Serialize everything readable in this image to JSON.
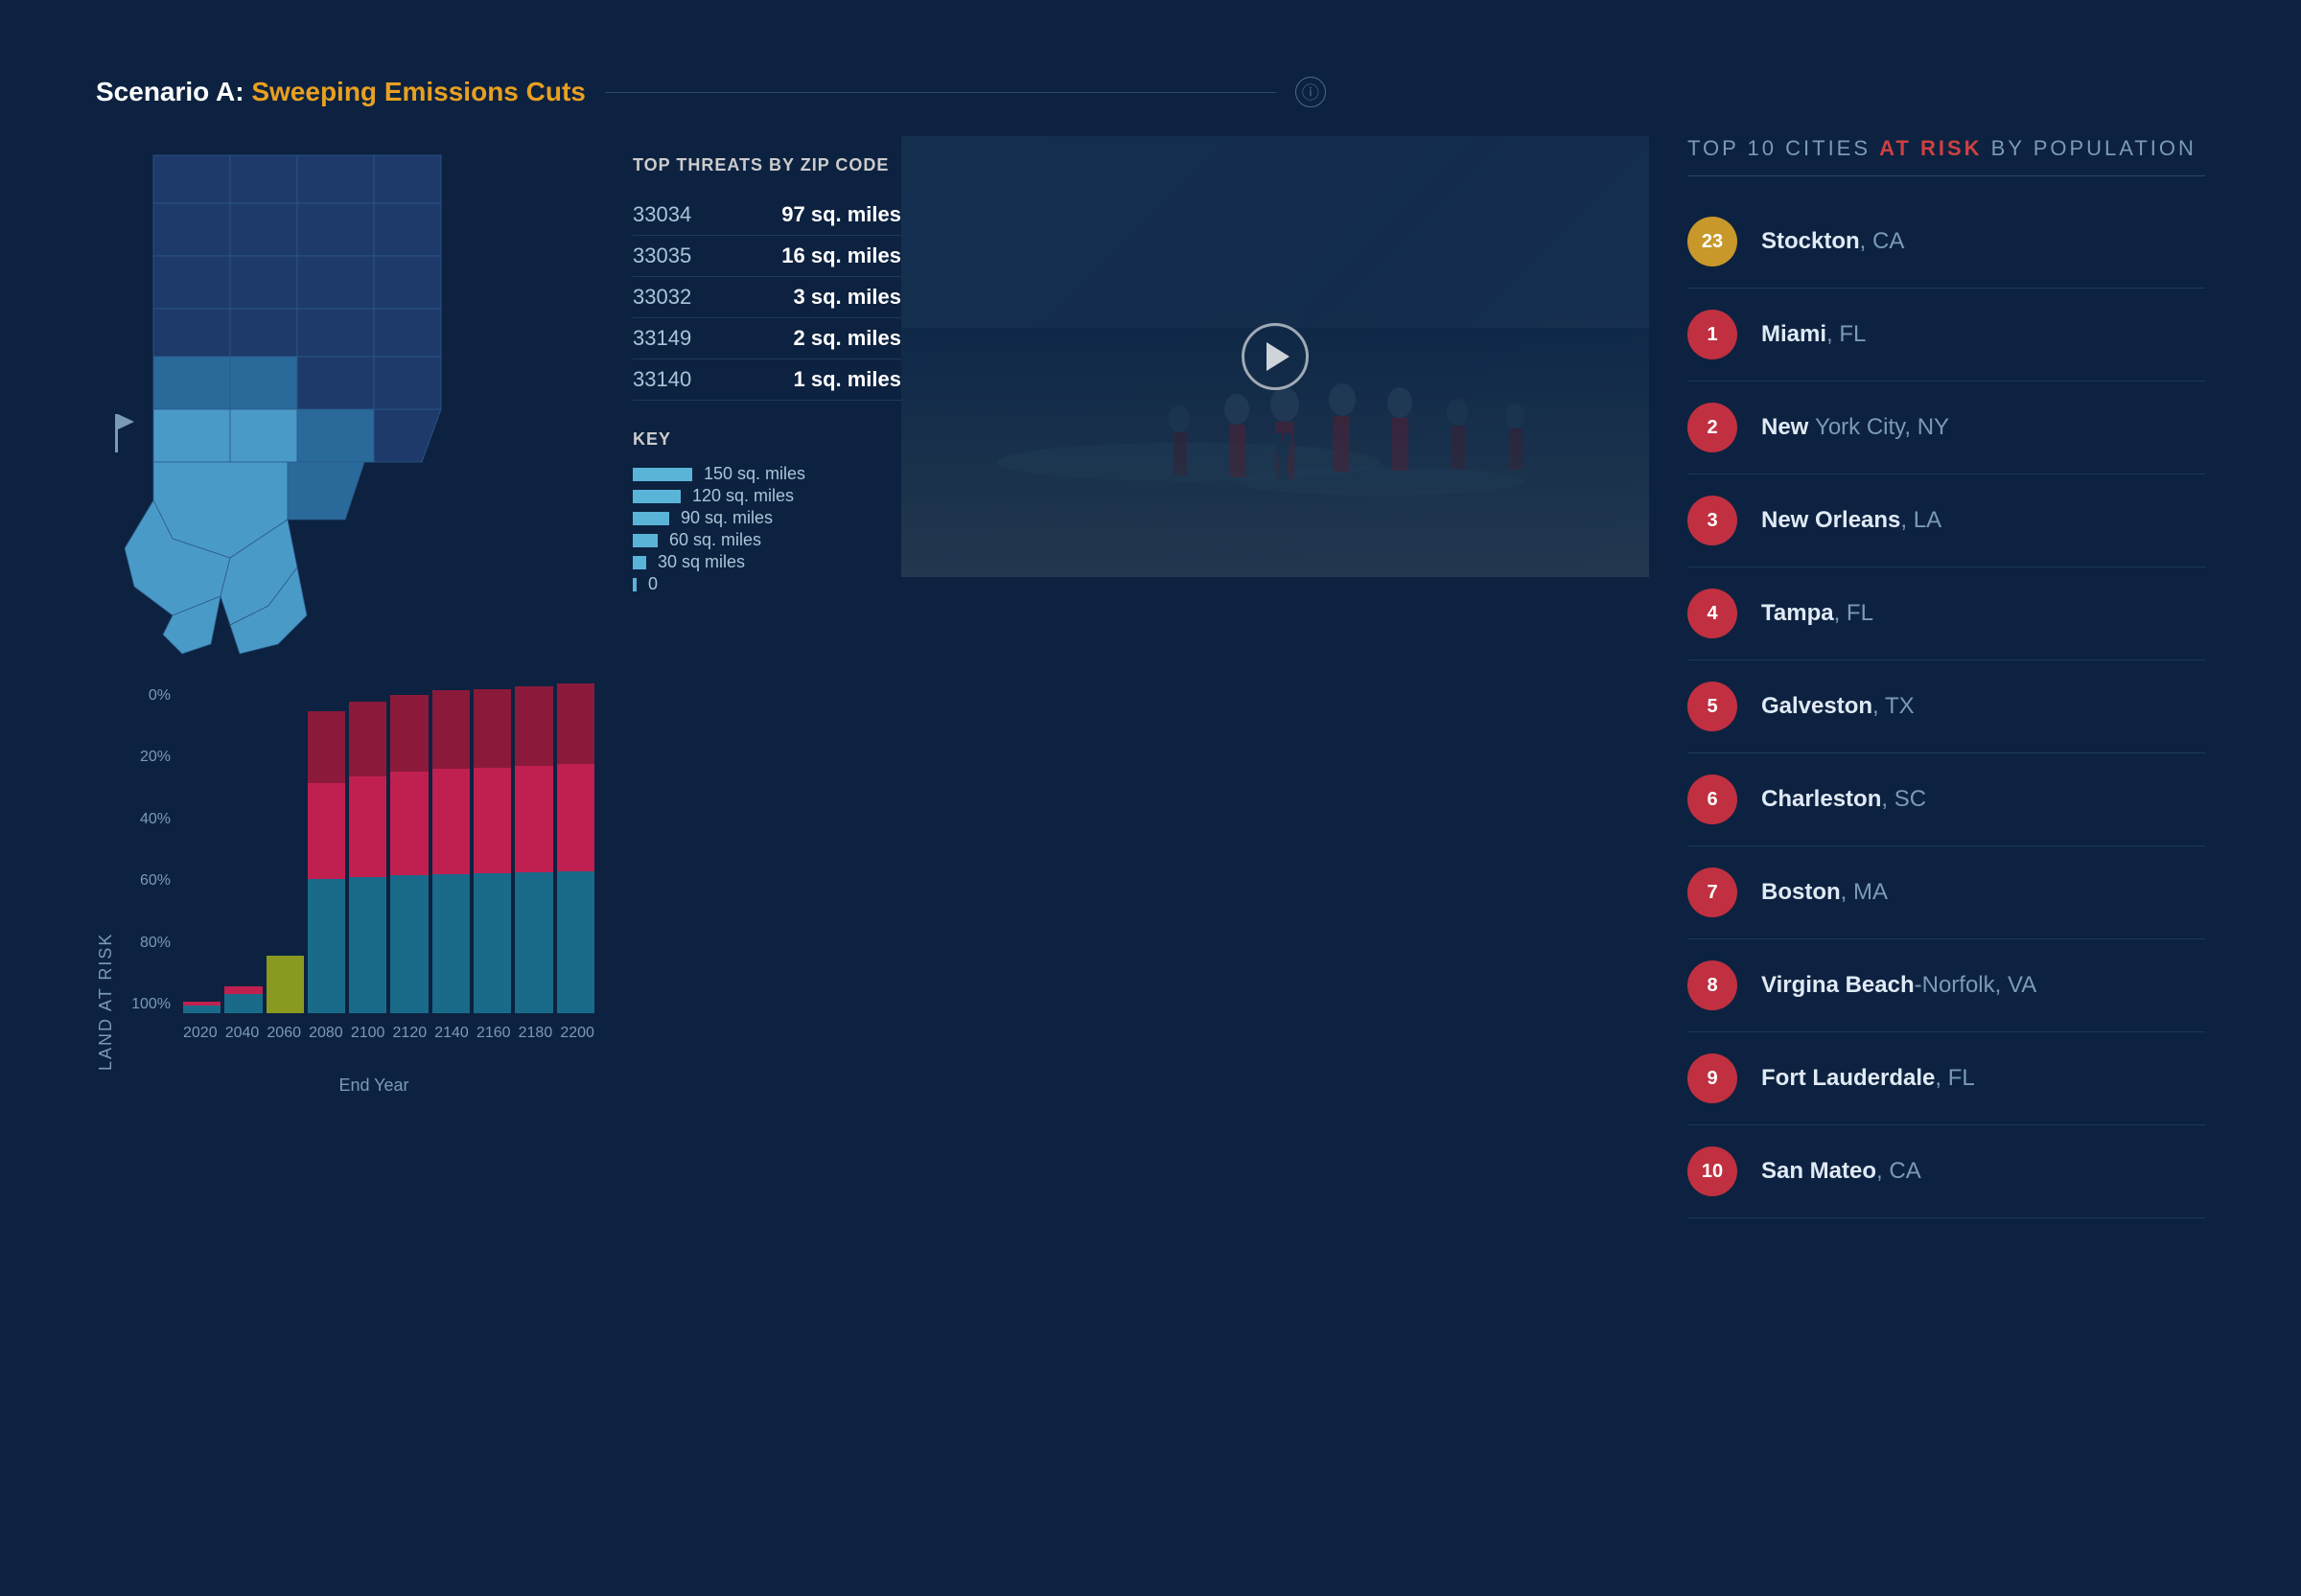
{
  "scenario": {
    "label": "Scenario A:",
    "name": "Sweeping Emissions Cuts"
  },
  "threats": {
    "title": "TOP THREATS BY ZIP CODE",
    "rows": [
      {
        "zip": "33034",
        "value": "97 sq. miles"
      },
      {
        "zip": "33035",
        "value": "16 sq. miles"
      },
      {
        "zip": "33032",
        "value": "3 sq. miles"
      },
      {
        "zip": "33149",
        "value": "2 sq. miles"
      },
      {
        "zip": "33140",
        "value": "1 sq. miles"
      }
    ]
  },
  "key": {
    "title": "KEY",
    "items": [
      {
        "label": "150 sq. miles",
        "width": 60
      },
      {
        "label": "120 sq. miles",
        "width": 48
      },
      {
        "label": "90 sq. miles",
        "width": 36
      },
      {
        "label": "60 sq. miles",
        "width": 24
      },
      {
        "label": "30 sq miles",
        "width": 12
      },
      {
        "label": "0",
        "width": 4
      }
    ]
  },
  "chart": {
    "y_label": "Land at Risk",
    "x_label": "End Year",
    "y_ticks": [
      "0%",
      "20%",
      "40%",
      "60%",
      "80%",
      "100%"
    ],
    "x_ticks": [
      "2020",
      "2040",
      "2060",
      "2080",
      "2100",
      "2120",
      "2140",
      "2160",
      "2180",
      "2200"
    ],
    "bars": [
      {
        "year": "2020",
        "teal": 2,
        "mid": 1,
        "dark": 0,
        "highlight": false
      },
      {
        "year": "2040",
        "teal": 5,
        "mid": 3,
        "dark": 0,
        "highlight": false
      },
      {
        "year": "2060",
        "teal": 10,
        "mid": 5,
        "dark": 0,
        "highlight": true
      },
      {
        "year": "2080",
        "teal": 38,
        "mid": 28,
        "dark": 20,
        "highlight": false
      },
      {
        "year": "2100",
        "teal": 38,
        "mid": 30,
        "dark": 22,
        "highlight": false
      },
      {
        "year": "2120",
        "teal": 38,
        "mid": 30,
        "dark": 22,
        "highlight": false
      },
      {
        "year": "2140",
        "teal": 38,
        "mid": 30,
        "dark": 23,
        "highlight": false
      },
      {
        "year": "2160",
        "teal": 38,
        "mid": 30,
        "dark": 23,
        "highlight": false
      },
      {
        "year": "2180",
        "teal": 38,
        "mid": 30,
        "dark": 23,
        "highlight": false
      },
      {
        "year": "2200",
        "teal": 38,
        "mid": 30,
        "dark": 23,
        "highlight": false
      }
    ]
  },
  "cities": {
    "title_prefix": "TOP 10 CITIES ",
    "title_risk": "AT RISK",
    "title_suffix": " BY POPULATION",
    "items": [
      {
        "rank": "23",
        "badge_type": "gold",
        "city_bold": "Stockton",
        "city_state": ", CA"
      },
      {
        "rank": "1",
        "badge_type": "red",
        "city_bold": "Miami",
        "city_state": ", FL"
      },
      {
        "rank": "2",
        "badge_type": "red",
        "city_bold": "New ",
        "city_rest": "York City",
        "city_state": ", NY"
      },
      {
        "rank": "3",
        "badge_type": "red",
        "city_bold": "New Orleans",
        "city_state": ", LA"
      },
      {
        "rank": "4",
        "badge_type": "red",
        "city_bold": "Tampa",
        "city_state": ", FL"
      },
      {
        "rank": "5",
        "badge_type": "red",
        "city_bold": "Galveston",
        "city_state": ", TX"
      },
      {
        "rank": "6",
        "badge_type": "red",
        "city_bold": "Charleston",
        "city_state": ", SC"
      },
      {
        "rank": "7",
        "badge_type": "red",
        "city_bold": "Boston",
        "city_state": ", MA"
      },
      {
        "rank": "8",
        "badge_type": "red",
        "city_bold": "Virgina Beach",
        "city_rest": "-Norfolk",
        "city_state": ", VA"
      },
      {
        "rank": "9",
        "badge_type": "red",
        "city_bold": "Fort Lauderdale",
        "city_state": ", FL"
      },
      {
        "rank": "10",
        "badge_type": "red",
        "city_bold": "San Mateo",
        "city_state": ", CA"
      }
    ]
  }
}
